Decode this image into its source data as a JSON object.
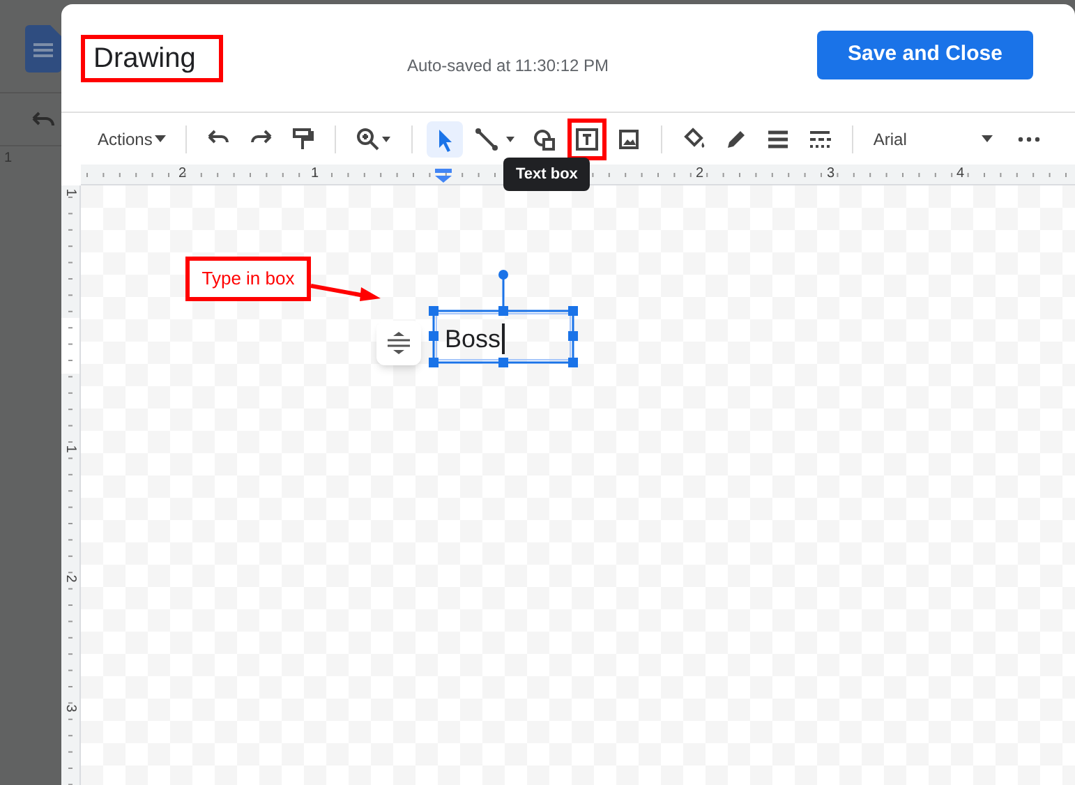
{
  "background": {
    "ruler_label": "1"
  },
  "dialog": {
    "title": "Drawing",
    "status": "Auto-saved at 11:30:12 PM",
    "save_button": "Save and Close"
  },
  "toolbar": {
    "actions_menu": "Actions",
    "font": "Arial",
    "tools": [
      {
        "kind": "undo",
        "selected": false
      },
      {
        "kind": "redo",
        "selected": false
      },
      {
        "kind": "paint",
        "selected": false
      },
      {
        "kind": "divider"
      },
      {
        "kind": "zoom",
        "selected": false
      },
      {
        "kind": "divider"
      },
      {
        "kind": "select",
        "selected": true
      },
      {
        "kind": "line",
        "selected": false
      },
      {
        "kind": "shape",
        "selected": false
      },
      {
        "kind": "textbox",
        "selected": false
      },
      {
        "kind": "image",
        "selected": false
      },
      {
        "kind": "divider"
      },
      {
        "kind": "fill",
        "selected": false
      },
      {
        "kind": "pen",
        "selected": false
      },
      {
        "kind": "weight",
        "selected": false
      },
      {
        "kind": "dash",
        "selected": false
      },
      {
        "kind": "divider"
      }
    ]
  },
  "tooltip": "Text box",
  "ruler": {
    "horizontal": [
      "2",
      "1",
      "2",
      "3",
      "4"
    ],
    "vertical": [
      "1",
      "1",
      "2",
      "3"
    ]
  },
  "text_box": {
    "text": "Boss"
  },
  "annotation": {
    "callout": "Type in box"
  }
}
